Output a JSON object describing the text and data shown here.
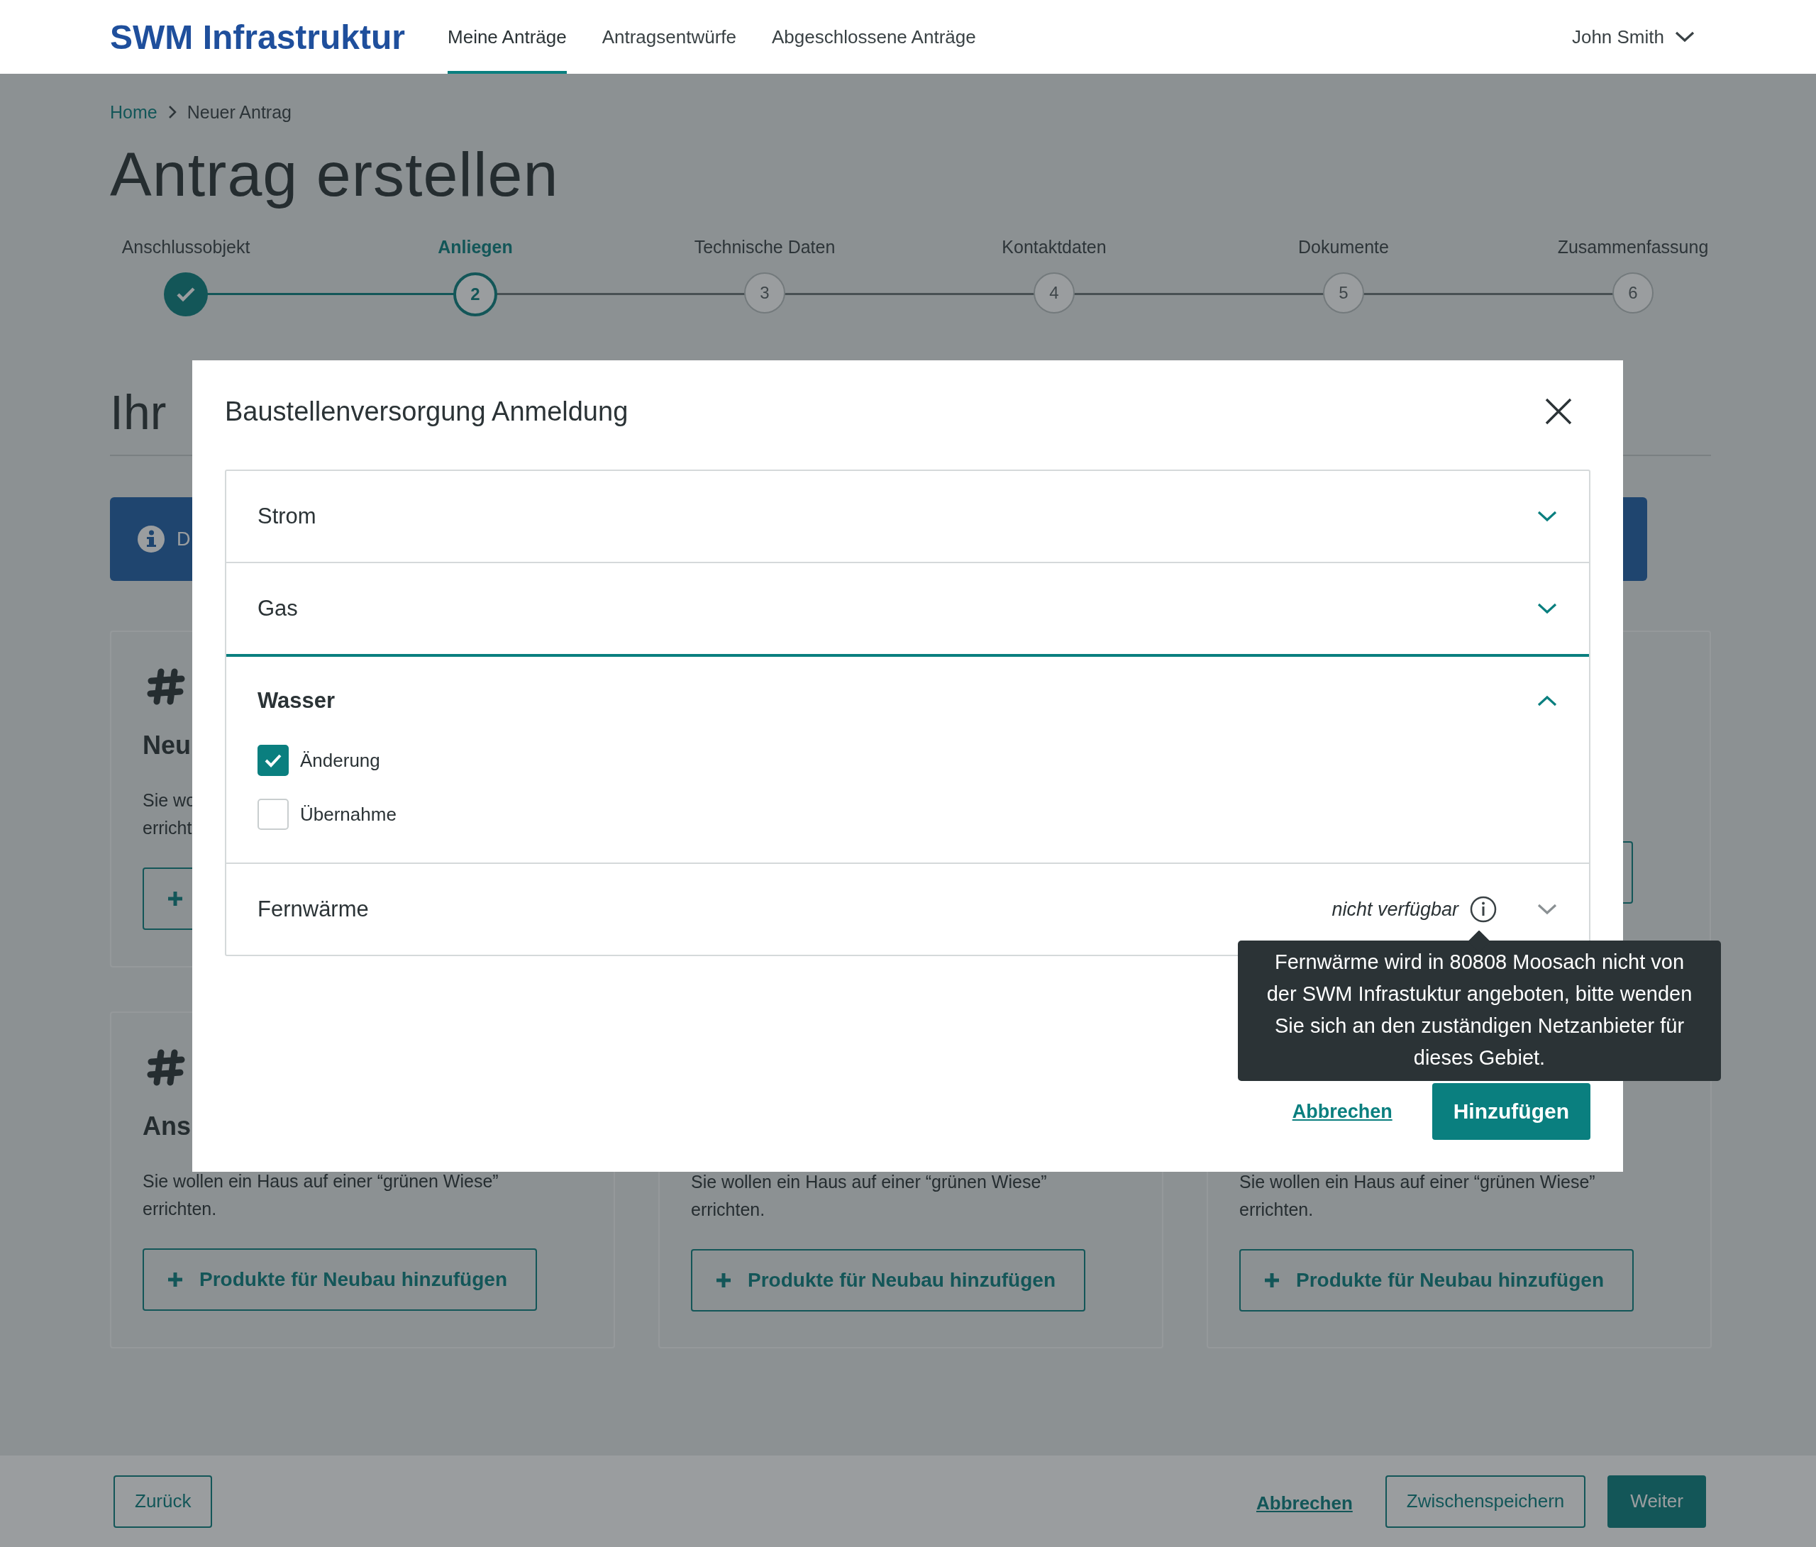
{
  "header": {
    "logo": "SWM Infrastruktur",
    "nav": [
      {
        "label": "Meine Anträge",
        "selected": true
      },
      {
        "label": "Antragsentwürfe",
        "selected": false
      },
      {
        "label": "Abgeschlossene Anträge",
        "selected": false
      }
    ],
    "user": "John Smith"
  },
  "breadcrumb": [
    {
      "label": "Home",
      "kind": "link"
    },
    {
      "label": "Neuer Antrag",
      "kind": "current"
    }
  ],
  "page_title": "Antrag erstellen",
  "steps": [
    {
      "label": "Anschlussobjekt",
      "done": true,
      "selected": false
    },
    {
      "label": "Anliegen",
      "number": "2",
      "done": false,
      "selected": true
    },
    {
      "label": "Technische Daten",
      "number": "3",
      "done": false,
      "selected": false
    },
    {
      "label": "Kontaktdaten",
      "number": "4",
      "done": false,
      "selected": false
    },
    {
      "label": "Dokumente",
      "number": "5",
      "done": false,
      "selected": false
    },
    {
      "label": "Zusammenfassung",
      "number": "6",
      "done": false,
      "selected": false
    }
  ],
  "section_heading": "Ihr",
  "info_banner": {
    "text": "D"
  },
  "cards_top": [
    {
      "title": "Neu",
      "text_lines": [
        "Sie wo",
        "erricht"
      ],
      "button": {
        "kind": "add"
      }
    },
    {
      "button": {
        "kind": "outline"
      }
    }
  ],
  "cards_bottom": [
    {
      "title": "Ans",
      "text_lines": [
        "Sie wollen ein Haus auf einer “grünen Wiese”",
        "errichten."
      ],
      "button": {
        "kind": "add",
        "label": "Produkte für Neubau hinzufügen"
      }
    },
    {
      "text_lines": [
        "Sie wollen ein Haus auf einer “grünen Wiese”",
        "errichten."
      ],
      "button": {
        "kind": "add",
        "label": "Produkte für Neubau hinzufügen"
      }
    },
    {
      "text_lines": [
        "Sie wollen ein Haus auf einer “grünen Wiese”",
        "errichten."
      ],
      "button": {
        "kind": "add",
        "label": "Produkte für Neubau hinzufügen"
      }
    }
  ],
  "modal": {
    "title": "Baustellenversorgung Anmeldung",
    "sections": [
      {
        "label": "Strom",
        "expanded": false,
        "disabled": false
      },
      {
        "label": "Gas",
        "expanded": false,
        "disabled": false
      },
      {
        "label": "Wasser",
        "expanded": true,
        "disabled": false,
        "options": [
          {
            "label": "Änderung",
            "checked": true
          },
          {
            "label": "Übernahme",
            "checked": false
          }
        ]
      },
      {
        "label": "Fernwärme",
        "expanded": false,
        "disabled": true,
        "status": "nicht verfügbar"
      }
    ],
    "tooltip": "Fernwärme wird in 80808 Moosach nicht von der SWM Infrastuktur angeboten, bitte wenden Sie sich an den zuständigen Netzanbieter für dieses Gebiet.",
    "cancel": "Abbrechen",
    "confirm": "Hinzufügen"
  },
  "footer": {
    "back": "Zurück",
    "cancel": "Abbrechen",
    "save": "Zwischenspeichern",
    "next": "Weiter"
  }
}
